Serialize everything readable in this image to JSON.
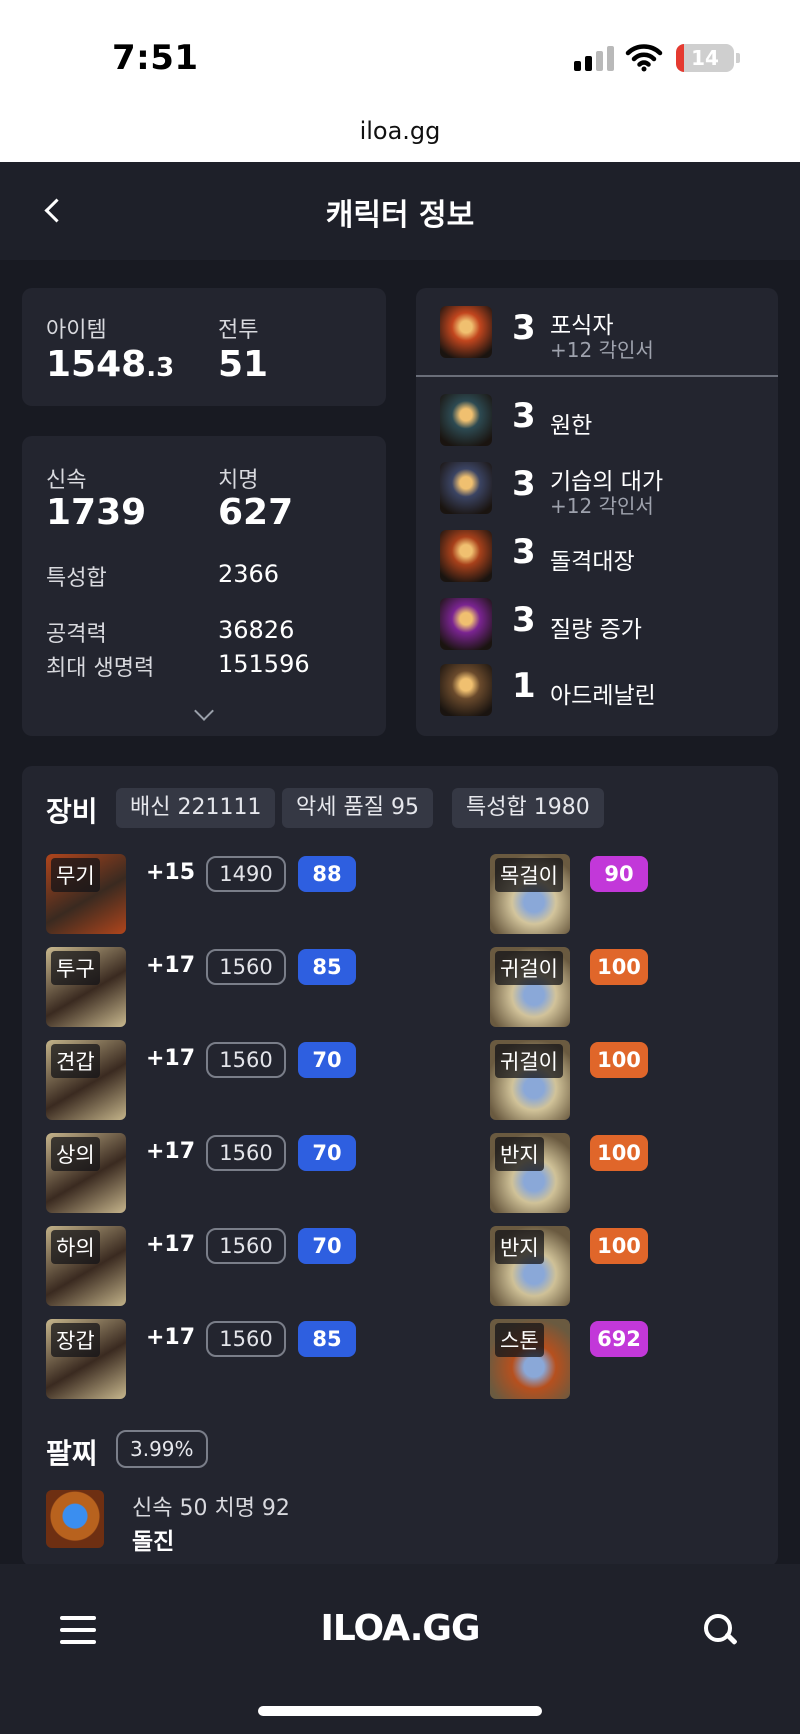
{
  "status_bar": {
    "time": "7:51",
    "battery": "14",
    "battery_fraction": 0.14
  },
  "browser": {
    "url": "iloa.gg"
  },
  "header": {
    "title": "캐릭터 정보"
  },
  "summary": {
    "item_level_label": "아이템",
    "item_level_main": "1548",
    "item_level_frac": ".3",
    "combat_label": "전투",
    "combat_value": "51"
  },
  "stats": {
    "swiftness_label": "신속",
    "swiftness_value": "1739",
    "crit_label": "치명",
    "crit_value": "627",
    "total_label": "특성합",
    "total_value": "2366",
    "attack_label": "공격력",
    "attack_value": "36826",
    "hp_label": "최대 생명력",
    "hp_value": "151596"
  },
  "engravings": [
    {
      "level": "3",
      "name": "포식자",
      "sub": "+12 각인서",
      "icon": "wolf-portrait-icon",
      "color": "#c2461e"
    },
    {
      "level": "3",
      "name": "원한",
      "sub": "",
      "icon": "grudge-icon",
      "color": "#2d4a52"
    },
    {
      "level": "3",
      "name": "기습의 대가",
      "sub": "+12 각인서",
      "icon": "ambush-icon",
      "color": "#3b4463"
    },
    {
      "level": "3",
      "name": "돌격대장",
      "sub": "",
      "icon": "charge-icon",
      "color": "#a8411b"
    },
    {
      "level": "3",
      "name": "질량 증가",
      "sub": "",
      "icon": "mass-increase-icon",
      "color": "#7a2491"
    },
    {
      "level": "1",
      "name": "아드레날린",
      "sub": "",
      "icon": "adrenaline-icon",
      "color": "#6a4a2c"
    }
  ],
  "equipment": {
    "title": "장비",
    "tags": [
      "배신 221111",
      "악세 품질 95",
      "특성합 1980"
    ],
    "gear": [
      {
        "label": "무기",
        "plus": "+15",
        "level": "1490",
        "quality": "88",
        "color": "#b0451c"
      },
      {
        "label": "투구",
        "plus": "+17",
        "level": "1560",
        "quality": "85",
        "color": "#c9b98f"
      },
      {
        "label": "견갑",
        "plus": "+17",
        "level": "1560",
        "quality": "70",
        "color": "#c4b48a"
      },
      {
        "label": "상의",
        "plus": "+17",
        "level": "1560",
        "quality": "70",
        "color": "#c6b58c"
      },
      {
        "label": "하의",
        "plus": "+17",
        "level": "1560",
        "quality": "70",
        "color": "#c2b289"
      },
      {
        "label": "장갑",
        "plus": "+17",
        "level": "1560",
        "quality": "85",
        "color": "#c7b78d"
      }
    ],
    "accessories": [
      {
        "label": "목걸이",
        "quality": "90",
        "badge_color": "#c238d9",
        "color": "#d3c59c"
      },
      {
        "label": "귀걸이",
        "quality": "100",
        "badge_color": "#e0662a",
        "color": "#d2c39a"
      },
      {
        "label": "귀걸이",
        "quality": "100",
        "badge_color": "#e0662a",
        "color": "#d1c399"
      },
      {
        "label": "반지",
        "quality": "100",
        "badge_color": "#e0662a",
        "color": "#d0c298"
      },
      {
        "label": "반지",
        "quality": "100",
        "badge_color": "#e0662a",
        "color": "#cfc197"
      },
      {
        "label": "스톤",
        "quality": "692",
        "badge_color": "#c238d9",
        "color": "#b6501e"
      }
    ]
  },
  "bracelet": {
    "title": "팔찌",
    "percent": "3.99%",
    "stats": "신속 50  치명 92",
    "effect": "돌진"
  },
  "bottom_nav": {
    "logo": "ILOA.GG"
  },
  "colors": {
    "quality_blue": "#2e5fe0",
    "card": "#23252f",
    "background": "#181a22"
  }
}
